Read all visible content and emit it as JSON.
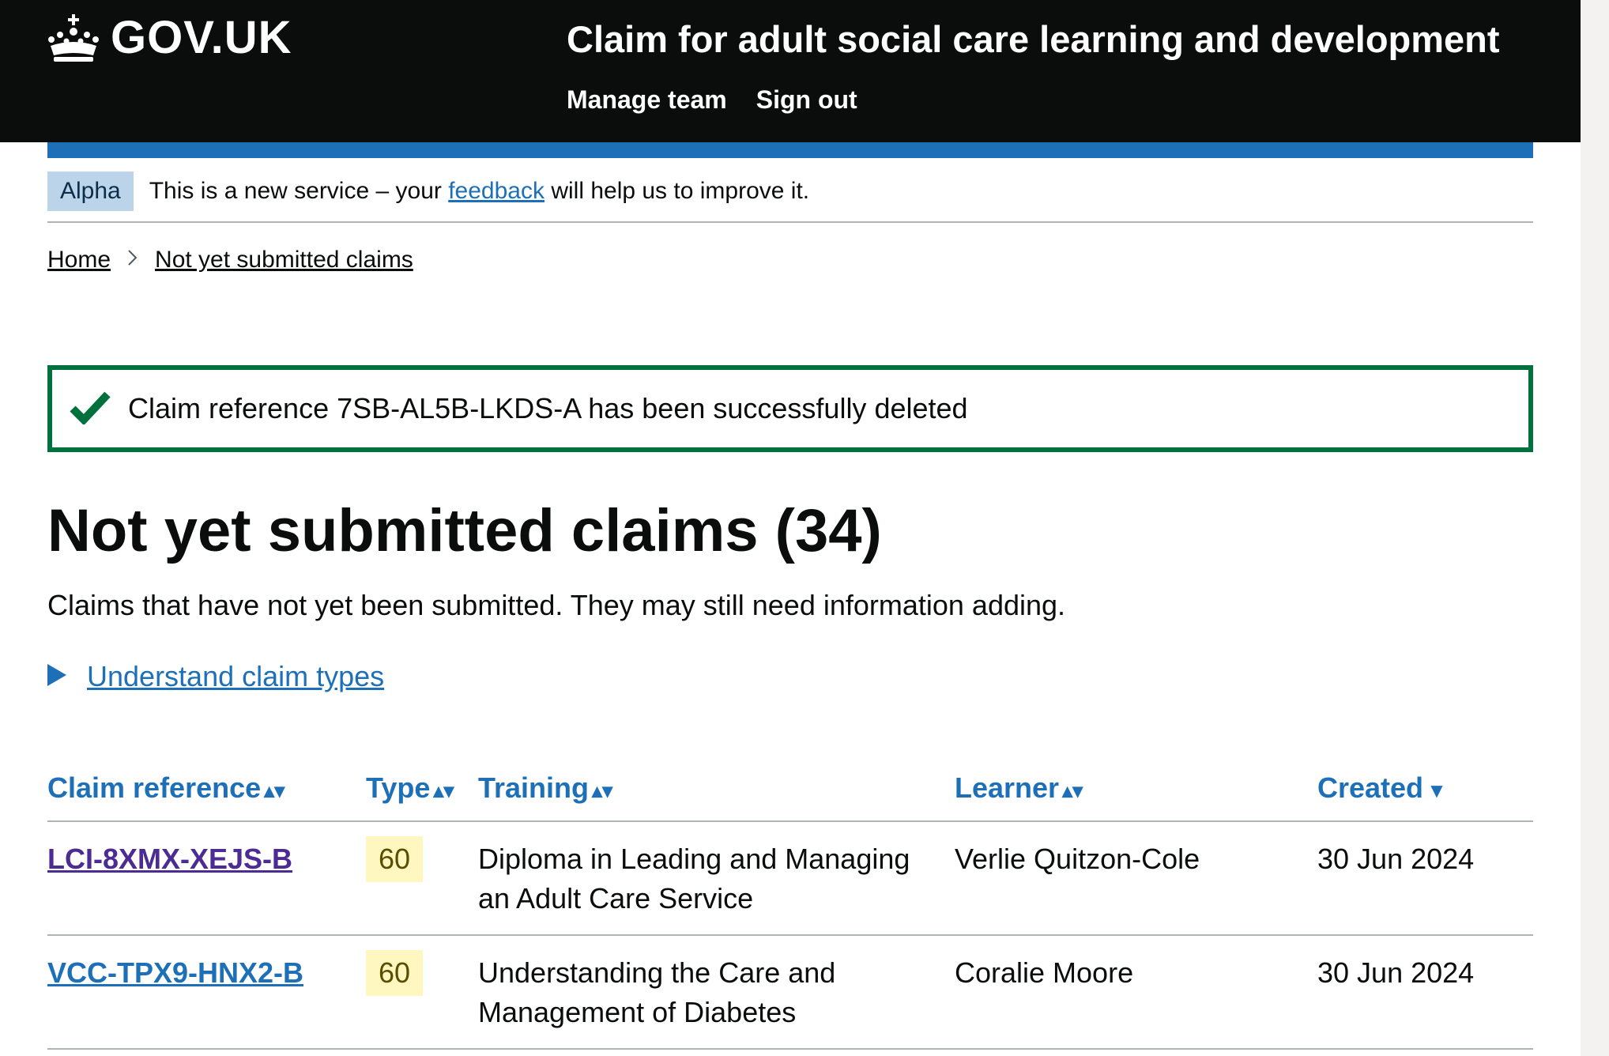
{
  "header": {
    "logo_text": "GOV.UK",
    "service_name": "Claim for adult social care learning and development",
    "nav": [
      "Manage team",
      "Sign out"
    ]
  },
  "phase_banner": {
    "tag": "Alpha",
    "text_before": "This is a new service – your",
    "link": "feedback",
    "text_after": "will help us to improve it."
  },
  "breadcrumb": [
    "Home",
    "Not yet submitted claims"
  ],
  "notification": {
    "message": "Claim reference 7SB-AL5B-LKDS-A has been successfully deleted",
    "color": "#00703c"
  },
  "page": {
    "title": "Not yet submitted claims (34)",
    "description": "Claims that have not yet been submitted. They may still need information adding.",
    "details_summary": "Understand claim types"
  },
  "table": {
    "headers": [
      "Claim reference",
      "Type",
      "Training",
      "Learner",
      "Created"
    ],
    "sort_icons": [
      "sort-both-icon",
      "sort-both-icon",
      "sort-both-icon",
      "sort-both-icon",
      "sort-descending-icon"
    ],
    "rows": [
      {
        "reference": "LCI-8XMX-XEJS-B",
        "type": "60",
        "training": "Diploma in Leading and Managing an Adult Care Service",
        "learner": "Verlie Quitzon-Cole",
        "created": "30 Jun 2024"
      },
      {
        "reference": "VCC-TPX9-HNX2-B",
        "type": "60",
        "training": "Understanding the Care and Management of Diabetes",
        "learner": "Coralie Moore",
        "created": "30 Jun 2024"
      }
    ]
  },
  "colors": {
    "header_bg": "#0b0c0c",
    "brand_blue": "#1d70b8",
    "link_visited": "#4c2c92",
    "type_tag_bg": "#fff7bf"
  }
}
